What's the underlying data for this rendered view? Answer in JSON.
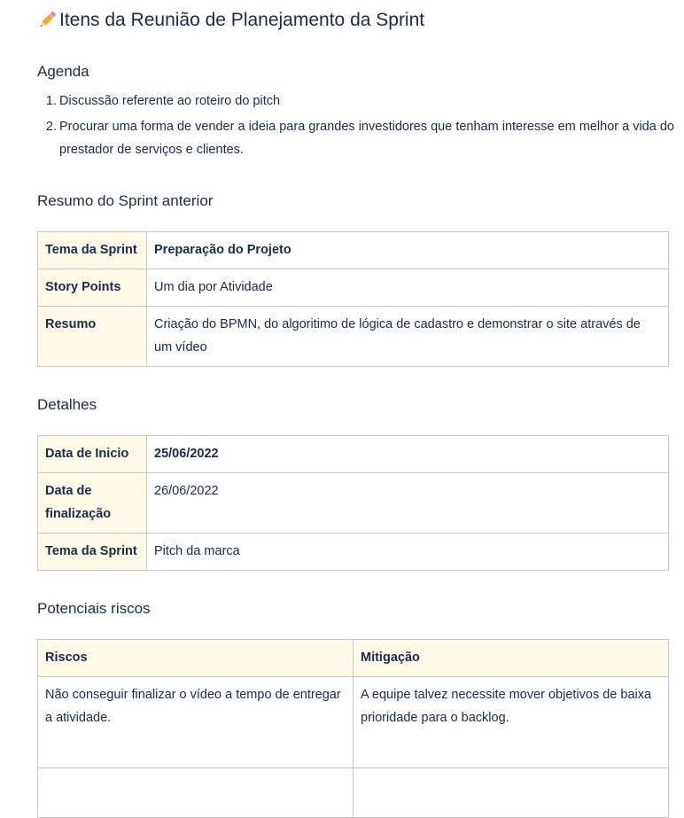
{
  "page": {
    "title": "Itens da Reunião de Planejamento da Sprint",
    "title_icon": "pencil-icon"
  },
  "agenda": {
    "heading": "Agenda",
    "items": [
      {
        "num": "1.",
        "text": "Discussão referente ao roteiro do pitch"
      },
      {
        "num": "2.",
        "text": "Procurar uma forma de vender a ideia para grandes investidores que tenham interesse em melhor a vida do prestador de serviços e clientes."
      }
    ]
  },
  "previous_sprint": {
    "heading": "Resumo do Sprint anterior",
    "rows": [
      {
        "key": "Tema da Sprint",
        "value": "Preparação do Projeto"
      },
      {
        "key": "Story Points",
        "value": "Um dia por Atividade"
      },
      {
        "key": "Resumo",
        "value": "Criação do BPMN, do algoritimo de lógica de cadastro e demonstrar o site através de um vídeo"
      }
    ]
  },
  "details": {
    "heading": "Detalhes",
    "rows": [
      {
        "key": "Data de Inicio",
        "value": "25/06/2022"
      },
      {
        "key": "Data de finalização",
        "value": "26/06/2022"
      },
      {
        "key": "Tema da Sprint",
        "value": "Pitch da marca"
      }
    ]
  },
  "risks": {
    "heading": "Potenciais riscos",
    "columns": [
      "Riscos",
      "Mitigação"
    ],
    "rows": [
      {
        "risk": "Não conseguir finalizar o vídeo a tempo de entregar a atividade.",
        "mitigation": "A equipe talvez necessite mover objetivos de baixa prioridade para o backlog."
      },
      {
        "risk": "",
        "mitigation": ""
      }
    ]
  },
  "colors": {
    "text": "#172b4d",
    "header_cell_bg": "#fffae6",
    "border": "#c1c7d0"
  }
}
